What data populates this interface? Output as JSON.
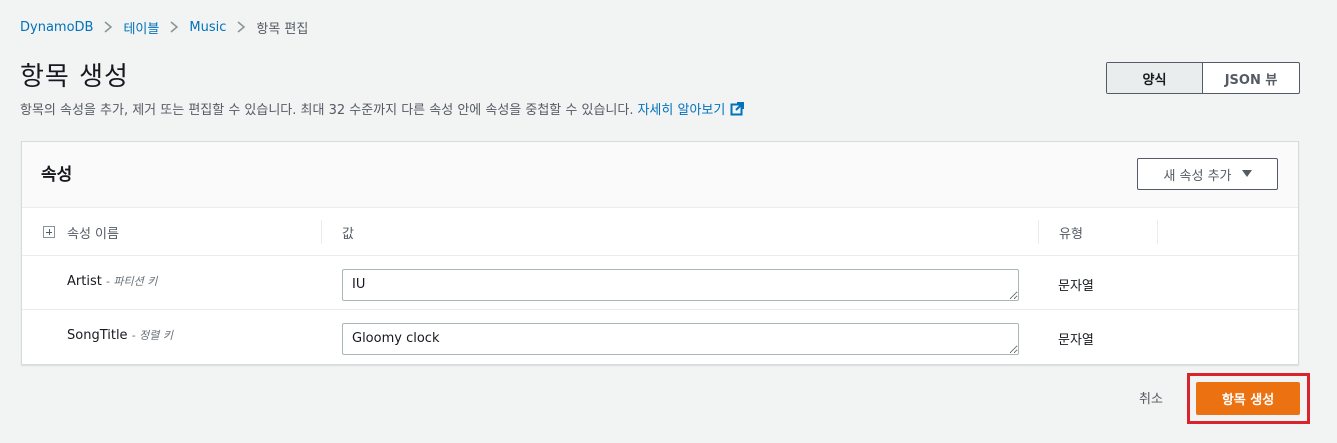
{
  "breadcrumb": {
    "items": [
      "DynamoDB",
      "테이블",
      "Music"
    ],
    "current": "항목 편집"
  },
  "page": {
    "title": "항목 생성",
    "description": "항목의 속성을 추가, 제거 또는 편집할 수 있습니다. 최대 32 수준까지 다른 속성 안에 속성을 중첩할 수 있습니다.",
    "learn_more": "자세히 알아보기"
  },
  "view_toggle": {
    "form_label": "양식",
    "json_label": "JSON 뷰",
    "active": "form"
  },
  "attributes_panel": {
    "title": "속성",
    "add_button_label": "새 속성 추가",
    "columns": {
      "name": "속성 이름",
      "value": "값",
      "type": "유형"
    },
    "rows": [
      {
        "name": "Artist",
        "key_label": "- 파티션 키",
        "value": "IU",
        "type": "문자열"
      },
      {
        "name": "SongTitle",
        "key_label": "- 정렬 키",
        "value": "Gloomy clock",
        "type": "문자열"
      }
    ]
  },
  "actions": {
    "cancel_label": "취소",
    "create_label": "항목 생성"
  },
  "colors": {
    "link": "#0073bb",
    "primary_button": "#ec7211",
    "highlight": "#d9242d"
  }
}
